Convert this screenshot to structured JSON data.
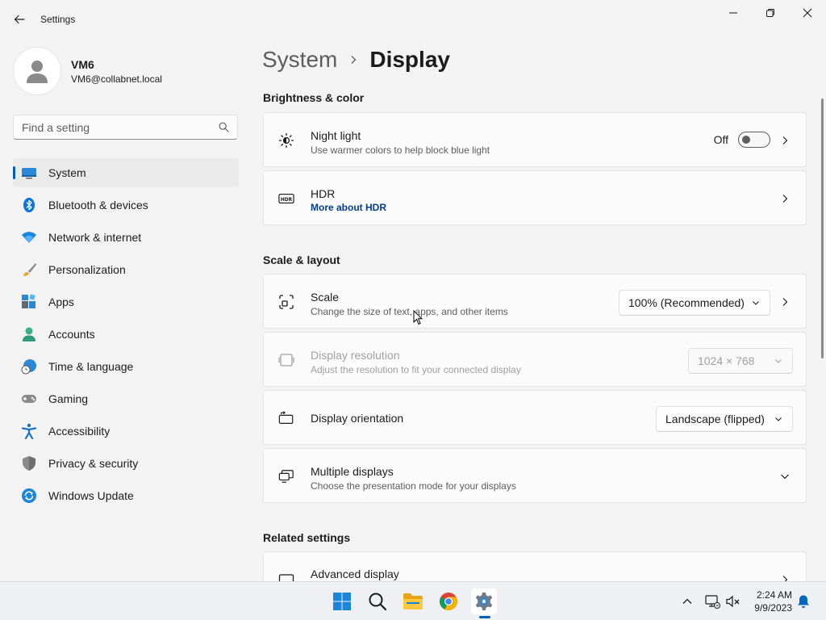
{
  "window": {
    "title": "Settings"
  },
  "profile": {
    "name": "VM6",
    "email": "VM6@collabnet.local"
  },
  "search": {
    "placeholder": "Find a setting"
  },
  "sidebar": {
    "items": [
      {
        "label": "System",
        "icon": "system-icon",
        "selected": true
      },
      {
        "label": "Bluetooth & devices",
        "icon": "bluetooth-icon"
      },
      {
        "label": "Network & internet",
        "icon": "wifi-icon"
      },
      {
        "label": "Personalization",
        "icon": "brush-icon"
      },
      {
        "label": "Apps",
        "icon": "apps-icon"
      },
      {
        "label": "Accounts",
        "icon": "account-icon"
      },
      {
        "label": "Time & language",
        "icon": "globe-clock-icon"
      },
      {
        "label": "Gaming",
        "icon": "gamepad-icon"
      },
      {
        "label": "Accessibility",
        "icon": "accessibility-icon"
      },
      {
        "label": "Privacy & security",
        "icon": "shield-icon"
      },
      {
        "label": "Windows Update",
        "icon": "update-icon"
      }
    ]
  },
  "breadcrumb": {
    "parent": "System",
    "current": "Display"
  },
  "sections": {
    "brightness": {
      "title": "Brightness & color",
      "night_light": {
        "title": "Night light",
        "desc": "Use warmer colors to help block blue light",
        "state": "Off"
      },
      "hdr": {
        "title": "HDR",
        "link": "More about HDR"
      }
    },
    "scale_layout": {
      "title": "Scale & layout",
      "scale": {
        "title": "Scale",
        "desc": "Change the size of text, apps, and other items",
        "value": "100% (Recommended)"
      },
      "resolution": {
        "title": "Display resolution",
        "desc": "Adjust the resolution to fit your connected display",
        "value": "1024 × 768"
      },
      "orientation": {
        "title": "Display orientation",
        "value": "Landscape (flipped)"
      },
      "multiple": {
        "title": "Multiple displays",
        "desc": "Choose the presentation mode for your displays"
      }
    },
    "related": {
      "title": "Related settings",
      "advanced": {
        "title": "Advanced display"
      }
    }
  },
  "taskbar": {
    "time": "2:24 AM",
    "date": "9/9/2023"
  },
  "colors": {
    "accent": "#005fb8",
    "link": "#003e92"
  }
}
